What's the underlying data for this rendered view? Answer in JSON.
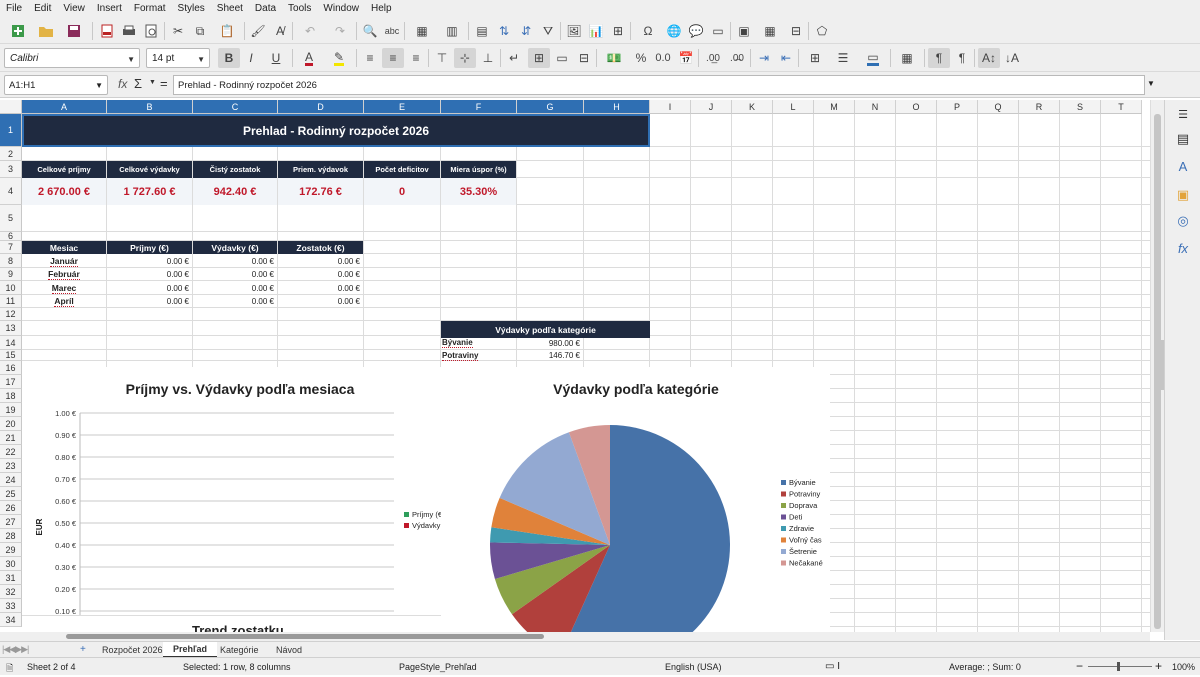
{
  "menu": [
    "File",
    "Edit",
    "View",
    "Insert",
    "Format",
    "Styles",
    "Sheet",
    "Data",
    "Tools",
    "Window",
    "Help"
  ],
  "toolbar": {
    "font_name": "Calibri",
    "font_size": "14 pt"
  },
  "formula_bar": {
    "name_box": "A1:H1",
    "formula": "Prehlad - Rodinný rozpočet 2026"
  },
  "columns": [
    "A",
    "B",
    "C",
    "D",
    "E",
    "F",
    "G",
    "H",
    "I",
    "J",
    "K",
    "L",
    "M",
    "N",
    "O",
    "P",
    "Q",
    "R",
    "S",
    "T"
  ],
  "rows": [
    "1",
    "2",
    "3",
    "4",
    "5",
    "6",
    "7",
    "8",
    "9",
    "10",
    "11",
    "12",
    "13",
    "14",
    "15",
    "16",
    "17",
    "18",
    "19",
    "20",
    "21",
    "22",
    "23",
    "24",
    "25",
    "26",
    "27",
    "28",
    "29",
    "30",
    "31",
    "32",
    "33",
    "34"
  ],
  "sheet": {
    "title": "Prehlad - Rodinný rozpočet 2026",
    "kpi_labels": [
      "Celkové príjmy",
      "Celkové výdavky",
      "Čistý zostatok",
      "Priem. výdavok",
      "Počet deficitov",
      "Miera úspor (%)"
    ],
    "kpi_values": [
      "2 670.00 €",
      "1 727.60 €",
      "942.40 €",
      "172.76 €",
      "0",
      "35.30%"
    ],
    "month_headers": [
      "Mesiac",
      "Príjmy (€)",
      "Výdavky (€)",
      "Zostatok (€)"
    ],
    "months": [
      {
        "name": "Január",
        "income": "0.00 €",
        "expense": "0.00 €",
        "balance": "0.00 €"
      },
      {
        "name": "Február",
        "income": "0.00 €",
        "expense": "0.00 €",
        "balance": "0.00 €"
      },
      {
        "name": "Marec",
        "income": "0.00 €",
        "expense": "0.00 €",
        "balance": "0.00 €"
      },
      {
        "name": "Apríl",
        "income": "0.00 €",
        "expense": "0.00 €",
        "balance": "0.00 €"
      }
    ],
    "category_header": "Výdavky podľa kategórie",
    "categories": [
      {
        "name": "Bývanie",
        "value": "980.00 €"
      },
      {
        "name": "Potraviny",
        "value": "146.70 €"
      }
    ],
    "partial_text": "Trend zostatku"
  },
  "chart_data": [
    {
      "type": "line",
      "title": "Príjmy vs. Výdavky podľa mesiaca",
      "ylabel": "EUR",
      "ylim": [
        0.0,
        1.0
      ],
      "y_ticks": [
        "1.00 €",
        "0.90 €",
        "0.80 €",
        "0.70 €",
        "0.60 €",
        "0.50 €",
        "0.40 €",
        "0.30 €",
        "0.20 €",
        "0.10 €"
      ],
      "grid": true,
      "legend_position": "right",
      "series": [
        {
          "name": "Príjmy (€",
          "color": "#2e9e5b",
          "values": [
            0,
            0,
            0,
            0
          ]
        },
        {
          "name": "Výdavky",
          "color": "#c0182a",
          "values": [
            0,
            0,
            0,
            0
          ]
        }
      ]
    },
    {
      "type": "pie",
      "title": "Výdavky podľa kategórie",
      "legend_position": "right",
      "slices": [
        {
          "name": "Bývanie",
          "value": 980.0,
          "color": "#4672a8"
        },
        {
          "name": "Potraviny",
          "value": 146.7,
          "color": "#b1403c"
        },
        {
          "name": "Doprava",
          "value": 90,
          "color": "#8ba347"
        },
        {
          "name": "Deti",
          "value": 85,
          "color": "#6b5195"
        },
        {
          "name": "Zdravie",
          "value": 35,
          "color": "#3f9ab0"
        },
        {
          "name": "Voľný čas",
          "value": 70,
          "color": "#e0823a"
        },
        {
          "name": "Šetrenie",
          "value": 225,
          "color": "#93a9d2"
        },
        {
          "name": "Nečakané",
          "value": 96,
          "color": "#d49793"
        }
      ]
    }
  ],
  "tabs": [
    "Rozpočet 2026",
    "Prehľad",
    "Kategórie",
    "Návod"
  ],
  "status": {
    "sheet": "Sheet 2 of 4",
    "selection": "Selected: 1 row, 8 columns",
    "page_style": "PageStyle_Prehľad",
    "language": "English (USA)",
    "sum": "Average: ; Sum: 0",
    "zoom": "100%"
  }
}
